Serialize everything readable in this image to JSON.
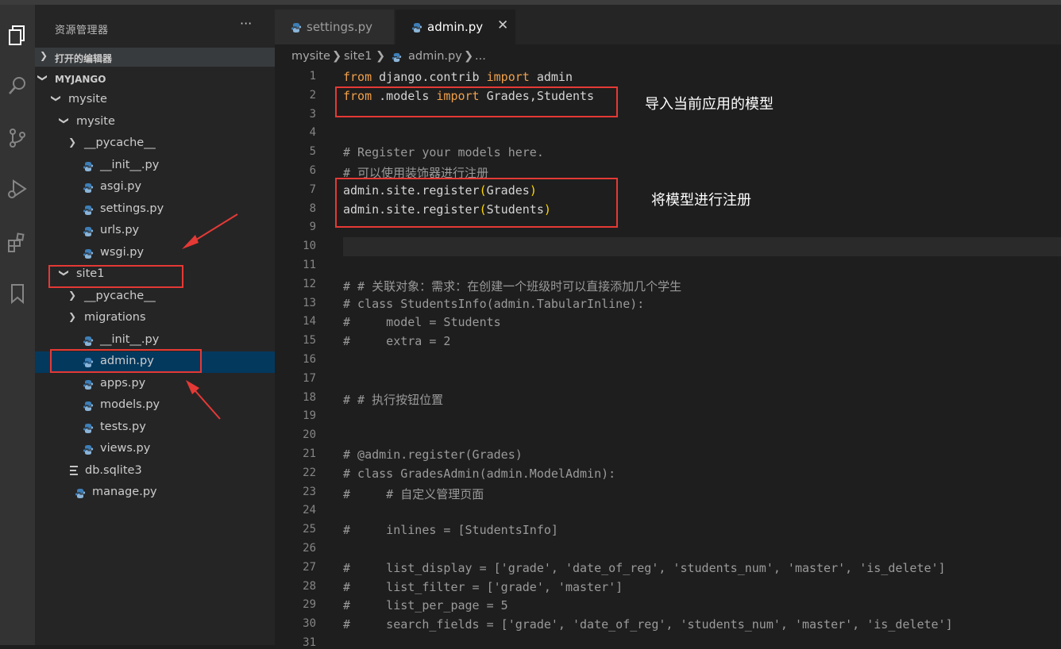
{
  "explorer": {
    "title": "资源管理器",
    "more": "···",
    "open_editors": "打开的编辑器",
    "project": "MYJANGO",
    "tree": [
      {
        "label": "mysite",
        "kind": "folder-open",
        "indent": 1
      },
      {
        "label": "mysite",
        "kind": "folder-open",
        "indent": 2
      },
      {
        "label": "__pycache__",
        "kind": "folder-closed",
        "indent": 3
      },
      {
        "label": "__init__.py",
        "kind": "python",
        "indent": 3
      },
      {
        "label": "asgi.py",
        "kind": "python",
        "indent": 3
      },
      {
        "label": "settings.py",
        "kind": "python",
        "indent": 3
      },
      {
        "label": "urls.py",
        "kind": "python",
        "indent": 3
      },
      {
        "label": "wsgi.py",
        "kind": "python",
        "indent": 3
      },
      {
        "label": "site1",
        "kind": "folder-open",
        "indent": 2
      },
      {
        "label": "__pycache__",
        "kind": "folder-closed",
        "indent": 3
      },
      {
        "label": "migrations",
        "kind": "folder-closed",
        "indent": 3
      },
      {
        "label": "__init__.py",
        "kind": "python",
        "indent": 3
      },
      {
        "label": "admin.py",
        "kind": "python",
        "indent": 3,
        "selected": true
      },
      {
        "label": "apps.py",
        "kind": "python",
        "indent": 3
      },
      {
        "label": "models.py",
        "kind": "python",
        "indent": 3
      },
      {
        "label": "tests.py",
        "kind": "python",
        "indent": 3
      },
      {
        "label": "views.py",
        "kind": "python",
        "indent": 3
      },
      {
        "label": "db.sqlite3",
        "kind": "file",
        "indent": 2
      },
      {
        "label": "manage.py",
        "kind": "python",
        "indent": 2
      }
    ]
  },
  "tabs": [
    {
      "label": "settings.py",
      "active": false
    },
    {
      "label": "admin.py",
      "active": true,
      "close": "✕"
    }
  ],
  "breadcrumb": {
    "p1": "mysite",
    "p2": "site1",
    "p3": "admin.py",
    "p4": "..."
  },
  "code": [
    [
      [
        "kw",
        "from"
      ],
      [
        "t",
        " django.contrib "
      ],
      [
        "kw",
        "import"
      ],
      [
        "t",
        " admin"
      ]
    ],
    [
      [
        "kw",
        "from"
      ],
      [
        "t",
        " .models "
      ],
      [
        "kw",
        "import"
      ],
      [
        "t",
        " Grades,Students"
      ]
    ],
    [],
    [],
    [
      [
        "cm",
        "# Register your models here."
      ]
    ],
    [
      [
        "cm",
        "# 可以使用装饰器进行注册"
      ]
    ],
    [
      [
        "t",
        "admin.site.register"
      ],
      [
        "br1",
        "("
      ],
      [
        "t",
        "Grades"
      ],
      [
        "br1",
        ")"
      ]
    ],
    [
      [
        "t",
        "admin.site.register"
      ],
      [
        "br1",
        "("
      ],
      [
        "t",
        "Students"
      ],
      [
        "br1",
        ")"
      ]
    ],
    [],
    [],
    [],
    [
      [
        "cm",
        "# # 关联对象：需求：在创建一个班级时可以直接添加几个学生"
      ]
    ],
    [
      [
        "cm",
        "# class StudentsInfo(admin.TabularInline):"
      ]
    ],
    [
      [
        "cm",
        "#     model = Students"
      ]
    ],
    [
      [
        "cm",
        "#     extra = 2"
      ]
    ],
    [],
    [],
    [
      [
        "cm",
        "# # 执行按钮位置"
      ]
    ],
    [],
    [],
    [
      [
        "cm",
        "# @admin.register(Grades)"
      ]
    ],
    [
      [
        "cm",
        "# class GradesAdmin(admin.ModelAdmin):"
      ]
    ],
    [
      [
        "cm",
        "#     # 自定义管理页面"
      ]
    ],
    [],
    [
      [
        "cm",
        "#     inlines = [StudentsInfo]"
      ]
    ],
    [],
    [
      [
        "cm",
        "#     list_display = ['grade', 'date_of_reg', 'students_num', 'master', 'is_delete']"
      ]
    ],
    [
      [
        "cm",
        "#     list_filter = ['grade', 'master']"
      ]
    ],
    [
      [
        "cm",
        "#     list_per_page = 5"
      ]
    ],
    [
      [
        "cm",
        "#     search_fields = ['grade', 'date_of_reg', 'students_num', 'master', 'is_delete']"
      ]
    ],
    []
  ],
  "annotations": {
    "import_note": "导入当前应用的模型",
    "register_note": "将模型进行注册"
  },
  "colors": {
    "annotation": "#e53935",
    "keyword": "#f0a04b",
    "comment": "#9a9a9a",
    "selection": "#04395e"
  }
}
